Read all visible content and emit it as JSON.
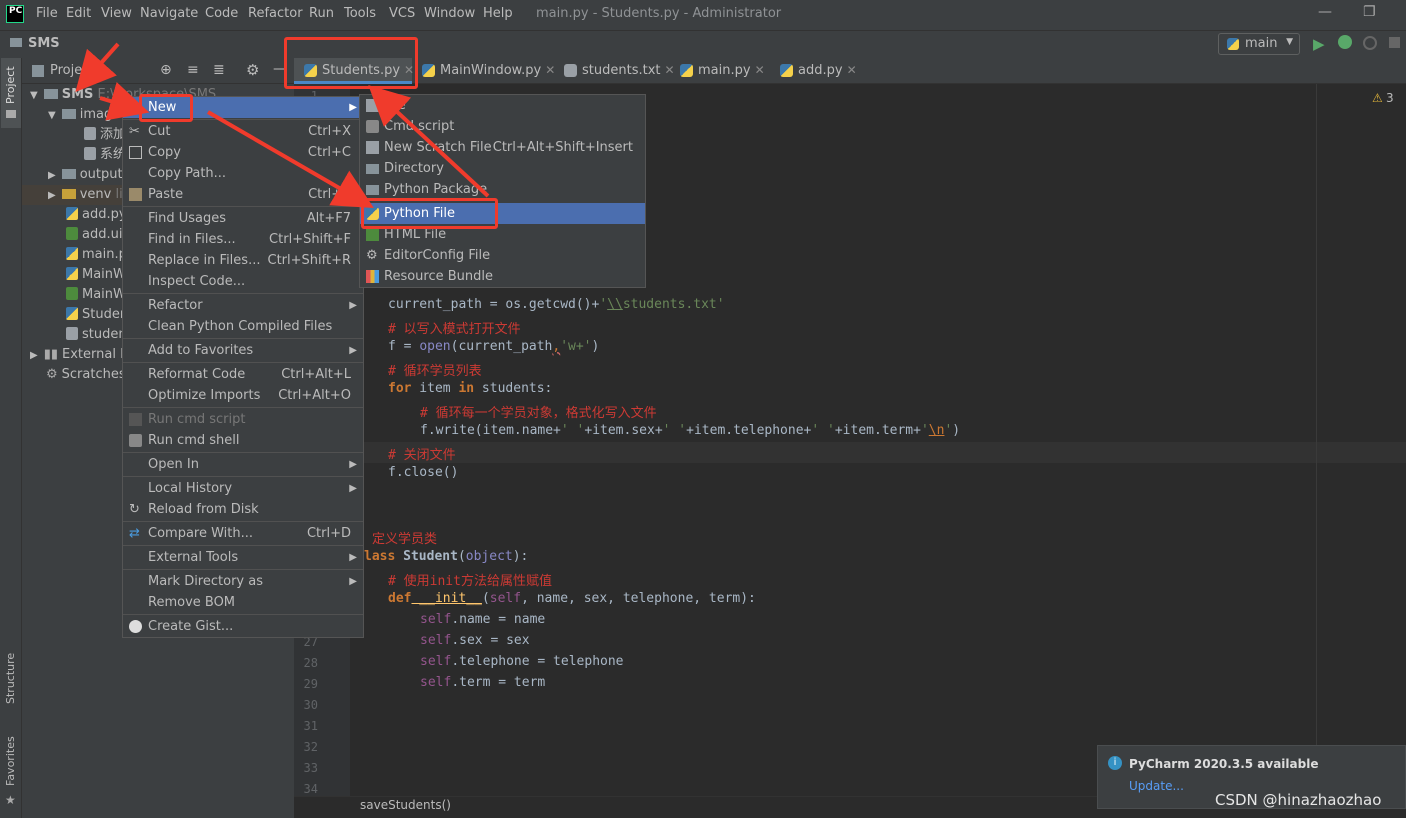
{
  "titlebar": {
    "logo": "PC",
    "menus": [
      "File",
      "Edit",
      "View",
      "Navigate",
      "Code",
      "Refactor",
      "Run",
      "Tools",
      "VCS",
      "Window",
      "Help"
    ],
    "title": "main.py - Students.py - Administrator"
  },
  "navbar": {
    "breadcrumb": "SMS",
    "run_config": "main"
  },
  "side_tools": {
    "project": "Project",
    "structure": "Structure",
    "favorites": "Favorites"
  },
  "project_panel": {
    "header": "Project"
  },
  "tabs": [
    {
      "label": "Students.py",
      "type": "py"
    },
    {
      "label": "MainWindow.py",
      "type": "py"
    },
    {
      "label": "students.txt",
      "type": "txt"
    },
    {
      "label": "main.py",
      "type": "py"
    },
    {
      "label": "add.py",
      "type": "py"
    }
  ],
  "tree": {
    "root": "SMS",
    "root_path": "E:\\workspace\\SMS",
    "items": [
      "image",
      "添加",
      "系统",
      "output",
      "venv",
      "add.py",
      "add.ui",
      "main.py",
      "MainW",
      "MainW",
      "Studen",
      "studen",
      "External Li",
      "Scratches"
    ],
    "venv_suffix": "li"
  },
  "editor": {
    "warnings": "3",
    "lines": {
      "l1": "1",
      "l27": "27",
      "l28": "28",
      "l29": "29",
      "l30": "30",
      "l31": "31",
      "l32": "32",
      "l33": "33",
      "l34": "34"
    },
    "code": {
      "c1a": "current_path",
      "c1b": " = os.getcwd()+",
      "c1c": "'",
      "c1d": "\\\\",
      "c1e": "students.txt'",
      "c2": "# 以写入模式打开文件",
      "c3a": "f = ",
      "c3b": "open",
      "c3c": "(current_path",
      "c3d": ",",
      "c3e": "'w+'",
      "c3f": ")",
      "c4": "# 循环学员列表",
      "c5a": "for",
      "c5b": " item ",
      "c5c": "in",
      "c5d": " students:",
      "c6": "# 循环每一个学员对象，格式化写入文件",
      "c7a": "f.write(item.name+",
      "c7b": "' '",
      "c7c": "+item.sex+",
      "c7d": "' '",
      "c7e": "+item.telephone+",
      "c7f": "' '",
      "c7g": "+item.term+",
      "c7h": "'",
      "c7i": "\\n",
      "c7j": "'",
      "c7k": ")",
      "c8": "# 关闭文件",
      "c9": "f.close()",
      "c10": "定义学员类",
      "c11a": "lass",
      "c11b": " Student",
      "c11c": "(",
      "c11d": "object",
      "c11e": "):",
      "c12": "# 使用init方法给属性赋值",
      "c13a": "def",
      "c13b": " __init__",
      "c13c": "(",
      "c13d": "self",
      "c13e": ", name, sex, telephone, term):",
      "c14a": "self",
      "c14b": ".name = name",
      "c15a": "self",
      "c15b": ".sex = sex",
      "c16a": "self",
      "c16b": ".telephone = telephone",
      "c17a": "self",
      "c17b": ".term = term"
    }
  },
  "statusbar": {
    "breadcrumb": "saveStudents()"
  },
  "context_menu": {
    "new": "New",
    "cut": "Cut",
    "cut_sc": "Ctrl+X",
    "copy": "Copy",
    "copy_sc": "Ctrl+C",
    "copy_path": "Copy Path...",
    "paste": "Paste",
    "paste_sc": "Ctrl+V",
    "find_usages": "Find Usages",
    "find_usages_sc": "Alt+F7",
    "find_in_files": "Find in Files...",
    "find_in_files_sc": "Ctrl+Shift+F",
    "replace_in_files": "Replace in Files...",
    "replace_in_files_sc": "Ctrl+Shift+R",
    "inspect_code": "Inspect Code...",
    "refactor": "Refactor",
    "clean_compiled": "Clean Python Compiled Files",
    "add_favorites": "Add to Favorites",
    "reformat": "Reformat Code",
    "reformat_sc": "Ctrl+Alt+L",
    "optimize_imports": "Optimize Imports",
    "optimize_imports_sc": "Ctrl+Alt+O",
    "run_cmd_script": "Run cmd script",
    "run_cmd_shell": "Run cmd shell",
    "open_in": "Open In",
    "local_history": "Local History",
    "reload_disk": "Reload from Disk",
    "compare_with": "Compare With...",
    "compare_with_sc": "Ctrl+D",
    "external_tools": "External Tools",
    "mark_directory": "Mark Directory as",
    "remove_bom": "Remove BOM",
    "create_gist": "Create Gist..."
  },
  "new_submenu": {
    "file": "File",
    "cmd_script": "Cmd script",
    "scratch": "New Scratch File",
    "scratch_sc": "Ctrl+Alt+Shift+Insert",
    "directory": "Directory",
    "python_package": "Python Package",
    "python_file": "Python File",
    "html_file": "HTML File",
    "editorconfig": "EditorConfig File",
    "resource_bundle": "Resource Bundle"
  },
  "notification": {
    "title": "PyCharm 2020.3.5 available",
    "link": "Update..."
  },
  "watermark": "CSDN @hinazhaozhao",
  "colors": {
    "accent": "#4b6eaf",
    "highlight_box": "#f03b2c",
    "arrow": "#f03b2c"
  }
}
